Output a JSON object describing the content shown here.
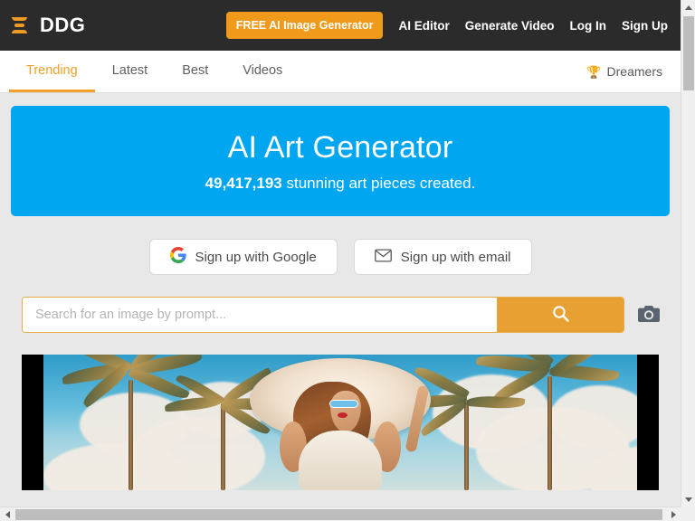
{
  "header": {
    "menu_icon": "hamburger-icon",
    "brand": "DDG",
    "cta_label": "FREE AI Image Generator",
    "links": [
      {
        "label": "AI Editor"
      },
      {
        "label": "Generate Video"
      },
      {
        "label": "Log In"
      },
      {
        "label": "Sign Up"
      }
    ]
  },
  "tabbar": {
    "tabs": [
      {
        "label": "Trending",
        "active": true
      },
      {
        "label": "Latest",
        "active": false
      },
      {
        "label": "Best",
        "active": false
      },
      {
        "label": "Videos",
        "active": false
      }
    ],
    "dreamers_label": "Dreamers",
    "dreamers_icon": "trophy-icon"
  },
  "hero": {
    "title": "AI Art Generator",
    "count": "49,417,193",
    "subtitle_rest": " stunning art pieces created.",
    "background_color": "#00a6ef"
  },
  "signup": {
    "google_label": "Sign up with Google",
    "google_icon": "google-g-icon",
    "email_label": "Sign up with email",
    "email_icon": "envelope-icon"
  },
  "search": {
    "placeholder": "Search for an image by prompt...",
    "value": "",
    "submit_icon": "magnifier-icon",
    "camera_icon": "camera-icon",
    "accent_color": "#e8a033"
  },
  "artwork": {
    "alt": "AI generated art: woman in wide white sun hat with blue sunglasses between palm trees under a cloudy blue sky"
  },
  "scrollbars": {
    "vertical_up_icon": "arrow-up-icon",
    "vertical_down_icon": "arrow-down-icon",
    "horizontal_left_icon": "arrow-left-icon",
    "horizontal_right_icon": "arrow-right-icon"
  }
}
